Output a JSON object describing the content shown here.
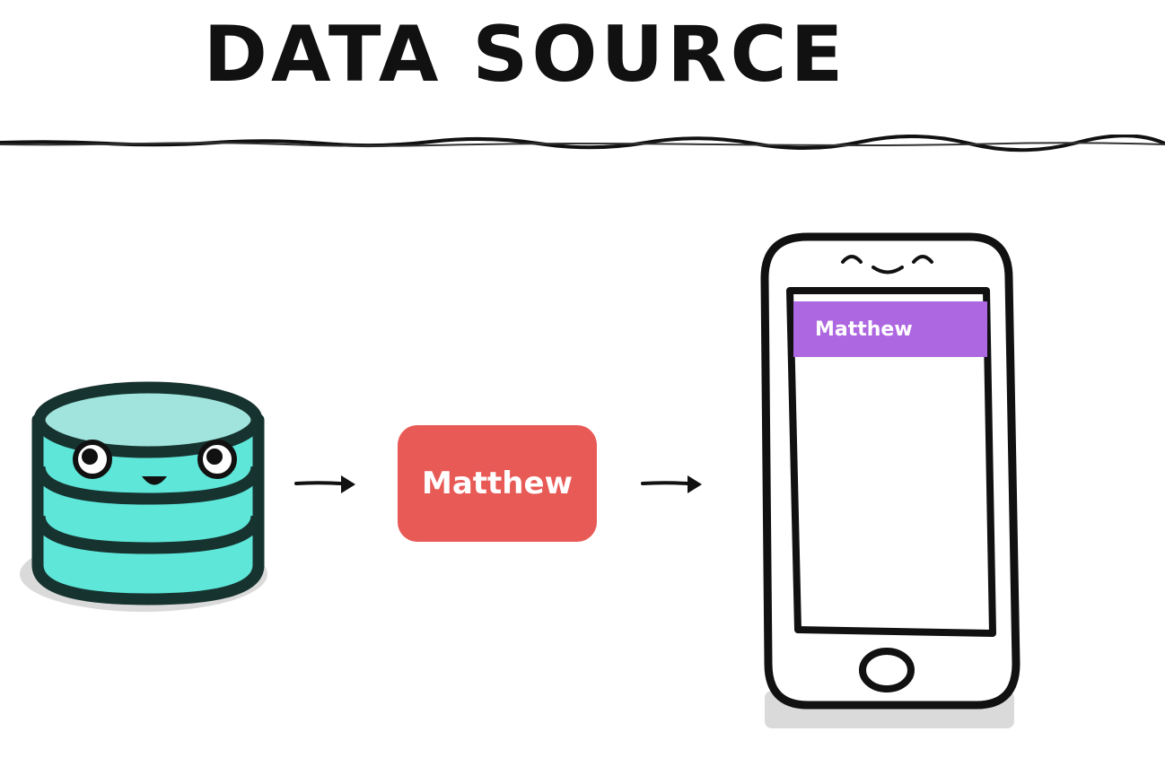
{
  "title": "DATA SOURCE",
  "data_record": {
    "label": "Matthew",
    "color": "#e85a56"
  },
  "phone_list": {
    "row_label": "Matthew",
    "row_color": "#ad67e0"
  },
  "database": {
    "icon": "database-icon",
    "color": "#5ee6d9"
  },
  "phone": {
    "icon": "smartphone-icon"
  },
  "arrows": [
    "arrow-right-icon",
    "arrow-right-icon"
  ]
}
